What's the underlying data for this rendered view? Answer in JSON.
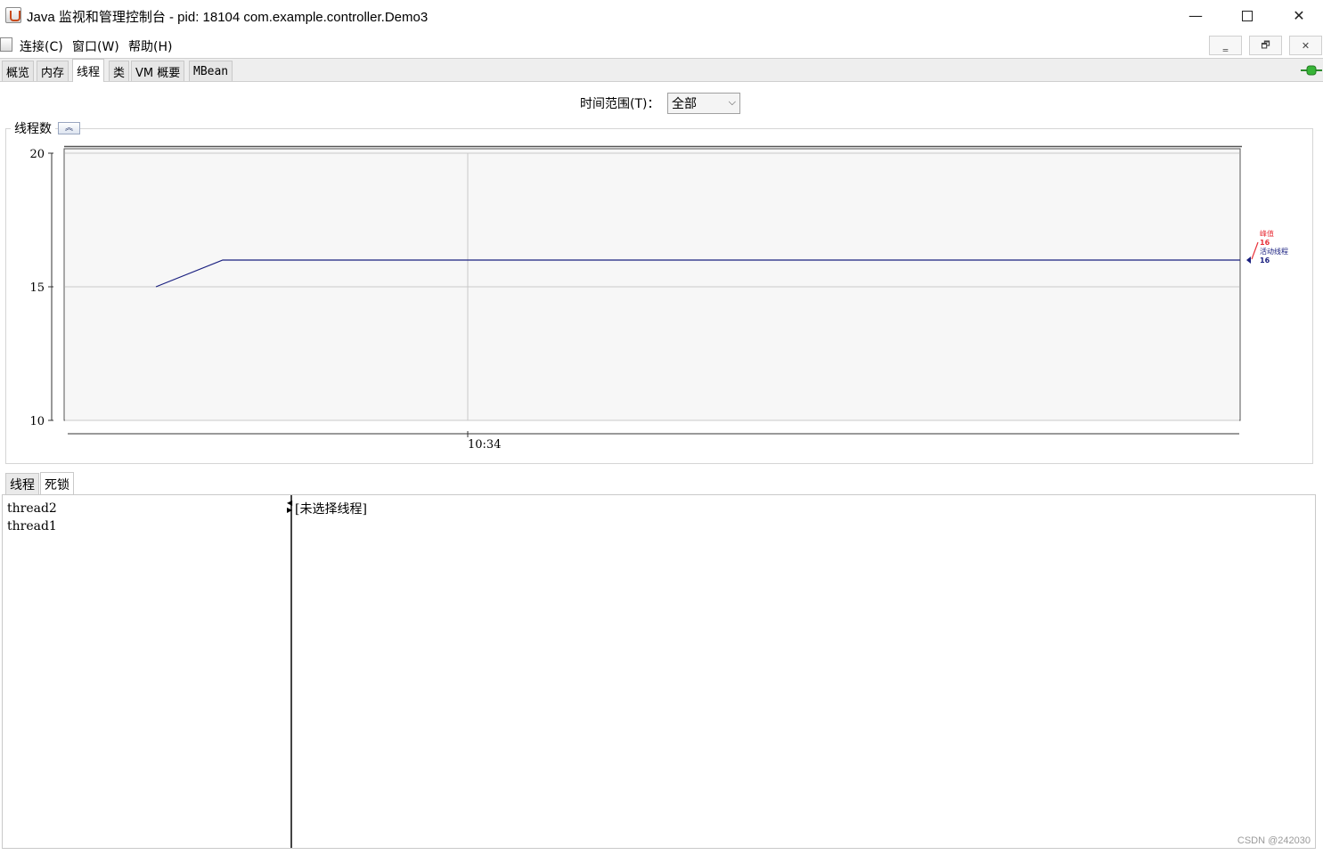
{
  "window": {
    "title": "Java 监视和管理控制台 - pid: 18104 com.example.controller.Demo3",
    "min_glyph": "—",
    "close_glyph": "✕"
  },
  "menu": [
    "连接(C)",
    "窗口(W)",
    "帮助(H)"
  ],
  "mdi_controls": [
    "‗",
    "🗗",
    "✕"
  ],
  "tabs": [
    {
      "label": "概览",
      "active": false
    },
    {
      "label": "内存",
      "active": false
    },
    {
      "label": "线程",
      "active": true
    },
    {
      "label": "类",
      "active": false
    },
    {
      "label": "VM 概要",
      "active": false
    },
    {
      "label": "MBean",
      "active": false
    }
  ],
  "time_range": {
    "label": "时间范围(T)：",
    "value": "全部",
    "chevron": "⌵"
  },
  "panel": {
    "title": "线程数",
    "collapse_glyph": "︽"
  },
  "legend": {
    "peak_label": "峰值",
    "peak_value": "16",
    "live_label": "活动线程",
    "live_value": "16",
    "peak_color": "#e8333b",
    "live_color": "#1a2080"
  },
  "chart_data": {
    "type": "line",
    "title": "线程数",
    "ylim": [
      10,
      20
    ],
    "y_ticks": [
      "20",
      "15",
      "10"
    ],
    "x_ticks": [
      "10:34"
    ],
    "series": [
      {
        "name": "活动线程",
        "color": "#1a2080",
        "values": [
          15,
          16,
          16,
          16
        ]
      },
      {
        "name": "峰值",
        "color": "#e8333b",
        "values": [
          16
        ]
      }
    ],
    "grid": true
  },
  "subtabs": [
    {
      "label": "线程",
      "active": false
    },
    {
      "label": "死锁",
      "active": true
    }
  ],
  "threads": [
    "thread2",
    "thread1"
  ],
  "detail_placeholder": "[未选择线程]",
  "watermark": "CSDN @242030"
}
